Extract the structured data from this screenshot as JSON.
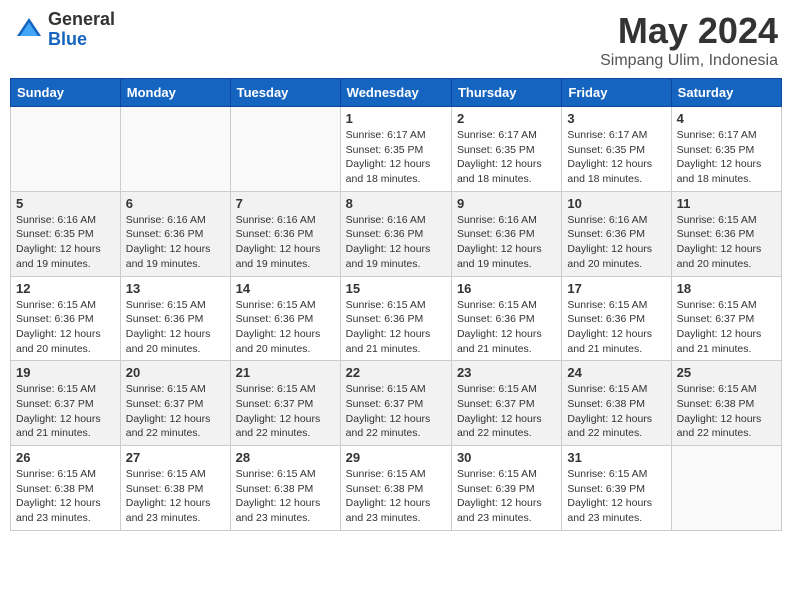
{
  "header": {
    "logo_general": "General",
    "logo_blue": "Blue",
    "title": "May 2024",
    "location": "Simpang Ulim, Indonesia"
  },
  "weekdays": [
    "Sunday",
    "Monday",
    "Tuesday",
    "Wednesday",
    "Thursday",
    "Friday",
    "Saturday"
  ],
  "weeks": [
    [
      {
        "day": "",
        "info": ""
      },
      {
        "day": "",
        "info": ""
      },
      {
        "day": "",
        "info": ""
      },
      {
        "day": "1",
        "info": "Sunrise: 6:17 AM\nSunset: 6:35 PM\nDaylight: 12 hours and 18 minutes."
      },
      {
        "day": "2",
        "info": "Sunrise: 6:17 AM\nSunset: 6:35 PM\nDaylight: 12 hours and 18 minutes."
      },
      {
        "day": "3",
        "info": "Sunrise: 6:17 AM\nSunset: 6:35 PM\nDaylight: 12 hours and 18 minutes."
      },
      {
        "day": "4",
        "info": "Sunrise: 6:17 AM\nSunset: 6:35 PM\nDaylight: 12 hours and 18 minutes."
      }
    ],
    [
      {
        "day": "5",
        "info": "Sunrise: 6:16 AM\nSunset: 6:35 PM\nDaylight: 12 hours and 19 minutes."
      },
      {
        "day": "6",
        "info": "Sunrise: 6:16 AM\nSunset: 6:36 PM\nDaylight: 12 hours and 19 minutes."
      },
      {
        "day": "7",
        "info": "Sunrise: 6:16 AM\nSunset: 6:36 PM\nDaylight: 12 hours and 19 minutes."
      },
      {
        "day": "8",
        "info": "Sunrise: 6:16 AM\nSunset: 6:36 PM\nDaylight: 12 hours and 19 minutes."
      },
      {
        "day": "9",
        "info": "Sunrise: 6:16 AM\nSunset: 6:36 PM\nDaylight: 12 hours and 19 minutes."
      },
      {
        "day": "10",
        "info": "Sunrise: 6:16 AM\nSunset: 6:36 PM\nDaylight: 12 hours and 20 minutes."
      },
      {
        "day": "11",
        "info": "Sunrise: 6:15 AM\nSunset: 6:36 PM\nDaylight: 12 hours and 20 minutes."
      }
    ],
    [
      {
        "day": "12",
        "info": "Sunrise: 6:15 AM\nSunset: 6:36 PM\nDaylight: 12 hours and 20 minutes."
      },
      {
        "day": "13",
        "info": "Sunrise: 6:15 AM\nSunset: 6:36 PM\nDaylight: 12 hours and 20 minutes."
      },
      {
        "day": "14",
        "info": "Sunrise: 6:15 AM\nSunset: 6:36 PM\nDaylight: 12 hours and 20 minutes."
      },
      {
        "day": "15",
        "info": "Sunrise: 6:15 AM\nSunset: 6:36 PM\nDaylight: 12 hours and 21 minutes."
      },
      {
        "day": "16",
        "info": "Sunrise: 6:15 AM\nSunset: 6:36 PM\nDaylight: 12 hours and 21 minutes."
      },
      {
        "day": "17",
        "info": "Sunrise: 6:15 AM\nSunset: 6:36 PM\nDaylight: 12 hours and 21 minutes."
      },
      {
        "day": "18",
        "info": "Sunrise: 6:15 AM\nSunset: 6:37 PM\nDaylight: 12 hours and 21 minutes."
      }
    ],
    [
      {
        "day": "19",
        "info": "Sunrise: 6:15 AM\nSunset: 6:37 PM\nDaylight: 12 hours and 21 minutes."
      },
      {
        "day": "20",
        "info": "Sunrise: 6:15 AM\nSunset: 6:37 PM\nDaylight: 12 hours and 22 minutes."
      },
      {
        "day": "21",
        "info": "Sunrise: 6:15 AM\nSunset: 6:37 PM\nDaylight: 12 hours and 22 minutes."
      },
      {
        "day": "22",
        "info": "Sunrise: 6:15 AM\nSunset: 6:37 PM\nDaylight: 12 hours and 22 minutes."
      },
      {
        "day": "23",
        "info": "Sunrise: 6:15 AM\nSunset: 6:37 PM\nDaylight: 12 hours and 22 minutes."
      },
      {
        "day": "24",
        "info": "Sunrise: 6:15 AM\nSunset: 6:38 PM\nDaylight: 12 hours and 22 minutes."
      },
      {
        "day": "25",
        "info": "Sunrise: 6:15 AM\nSunset: 6:38 PM\nDaylight: 12 hours and 22 minutes."
      }
    ],
    [
      {
        "day": "26",
        "info": "Sunrise: 6:15 AM\nSunset: 6:38 PM\nDaylight: 12 hours and 23 minutes."
      },
      {
        "day": "27",
        "info": "Sunrise: 6:15 AM\nSunset: 6:38 PM\nDaylight: 12 hours and 23 minutes."
      },
      {
        "day": "28",
        "info": "Sunrise: 6:15 AM\nSunset: 6:38 PM\nDaylight: 12 hours and 23 minutes."
      },
      {
        "day": "29",
        "info": "Sunrise: 6:15 AM\nSunset: 6:38 PM\nDaylight: 12 hours and 23 minutes."
      },
      {
        "day": "30",
        "info": "Sunrise: 6:15 AM\nSunset: 6:39 PM\nDaylight: 12 hours and 23 minutes."
      },
      {
        "day": "31",
        "info": "Sunrise: 6:15 AM\nSunset: 6:39 PM\nDaylight: 12 hours and 23 minutes."
      },
      {
        "day": "",
        "info": ""
      }
    ]
  ]
}
